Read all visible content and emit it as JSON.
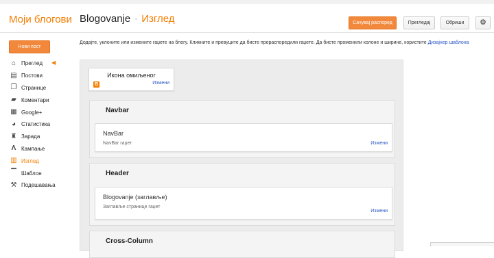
{
  "header": {
    "brand": "Моји блогови",
    "blog_name": "Blogovanje",
    "separator": "·",
    "page_title": "Изглед",
    "save_label": "Сачувај распоред",
    "preview_label": "Прегледај",
    "delete_label": "Обриши",
    "settings_icon": "gear-icon"
  },
  "sidebar": {
    "new_post_label": "Нови пост",
    "items": [
      {
        "label": "Преглед",
        "icon": "home-icon"
      },
      {
        "label": "Постови",
        "icon": "posts-icon"
      },
      {
        "label": "Странице",
        "icon": "pages-icon"
      },
      {
        "label": "Коментари",
        "icon": "comments-icon"
      },
      {
        "label": "Google+",
        "icon": "google-plus-icon"
      },
      {
        "label": "Статистика",
        "icon": "stats-icon"
      },
      {
        "label": "Зарада",
        "icon": "earnings-icon"
      },
      {
        "label": "Кампање",
        "icon": "campaigns-icon"
      },
      {
        "label": "Изглед",
        "icon": "layout-icon",
        "active": true
      },
      {
        "label": "Шаблон",
        "icon": "template-icon"
      },
      {
        "label": "Подешавања",
        "icon": "settings-icon"
      }
    ]
  },
  "main": {
    "intro_text": "Додајте, уклоните или измените гаџете на блогу. Кликните и превуците да бисте прераспоредили гаџете. Да бисте променили колоне и ширине, користите",
    "intro_link": "Дизајнер шаблона",
    "favicon_gadget": {
      "title": "Икона омиљеног",
      "edit": "Измени"
    },
    "sections": [
      {
        "title": "Navbar",
        "gadget_name": "NavBar",
        "gadget_type": "NavBar гаџет",
        "edit": "Измени"
      },
      {
        "title": "Header",
        "gadget_name": "Blogovanje (заглавље)",
        "gadget_type": "Заглавље странице гаџет",
        "edit": "Измени"
      },
      {
        "title": "Cross-Column"
      }
    ]
  },
  "colors": {
    "accent": "#f57d00",
    "button_orange": "#f1883b",
    "link": "#2b57c4"
  }
}
